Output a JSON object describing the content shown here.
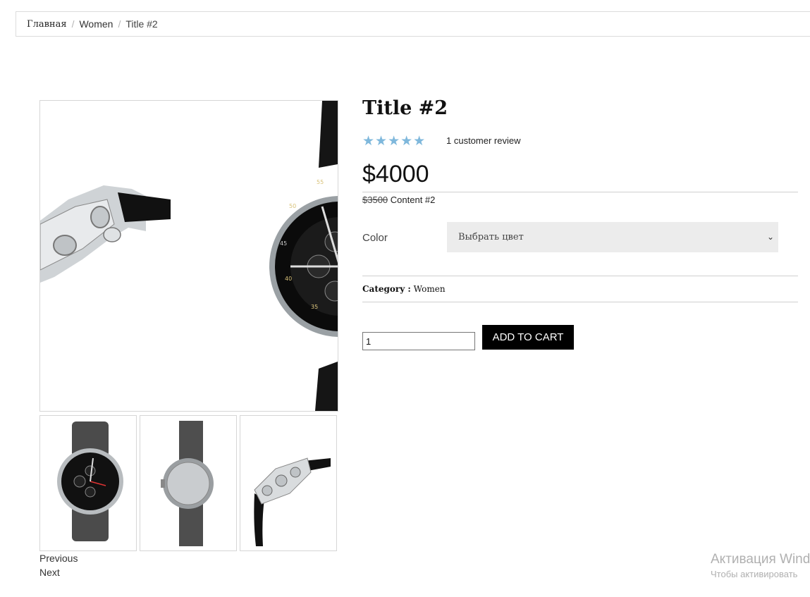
{
  "breadcrumb": {
    "home": "Главная",
    "separator": "/",
    "category": "Women",
    "current": "Title #2"
  },
  "gallery": {
    "main_image": "watch-side-and-front-image",
    "thumbnails": [
      "watch-front-thumb",
      "watch-back-thumb",
      "watch-side-thumb"
    ],
    "previous_label": "Previous",
    "next_label": "Next"
  },
  "product": {
    "title": "Title #2",
    "rating": 5,
    "rating_max": 5,
    "stars": "★★★★★",
    "review_text": "1 customer review",
    "price": "$4000",
    "old_price": "$3500",
    "content": "Content #2",
    "color_label": "Color",
    "color_select_value": "Выбрать цвет",
    "category_label": "Category :",
    "category_value": "Women",
    "quantity": "1",
    "add_to_cart_label": "ADD TO CART"
  },
  "watermark": {
    "title": "Активация Wind",
    "subtitle": "Чтобы активировать"
  },
  "colors": {
    "star": "#7fb8dc",
    "button_bg": "#000000",
    "select_bg": "#ececec"
  }
}
